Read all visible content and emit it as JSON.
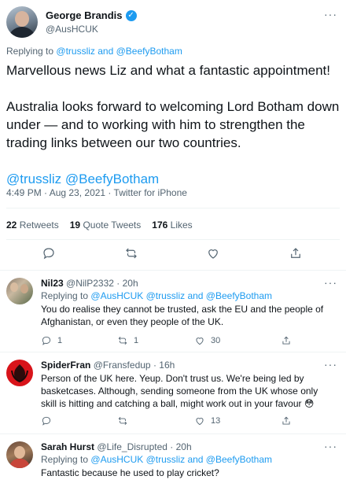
{
  "main_tweet": {
    "author_name": "George Brandis",
    "author_handle": "@AusHCUK",
    "more_glyph": "···",
    "replying_prefix": "Replying to",
    "replying_mentions": "@trussliz and @BeefyBotham",
    "body_paragraph_1": "Marvellous news Liz and what a fantastic appointment!",
    "body_paragraph_2": "Australia looks forward to welcoming Lord Botham down under — and to working with him to strengthen the trading links between our two countries.",
    "body_mentions": "@trussliz @BeefyBotham",
    "timestamp": "4:49 PM · Aug 23, 2021 · Twitter for iPhone",
    "stats": {
      "retweets_count": "22",
      "retweets_label": "Retweets",
      "quotes_count": "19",
      "quotes_label": "Quote Tweets",
      "likes_count": "176",
      "likes_label": "Likes"
    },
    "actions": [
      "reply-icon",
      "retweet-icon",
      "like-icon",
      "share-icon"
    ]
  },
  "replies": [
    {
      "name": "Nil23",
      "handle": "@NilP2332",
      "time": "· 20h",
      "replying_prefix": "Replying to",
      "replying_mentions": "@AusHCUK @trussliz and @BeefyBotham",
      "text": "You do realise they cannot be trusted, ask the EU and the people of Afghanistan, or even they people of the UK.",
      "reply_count": "1",
      "retweet_count": "1",
      "like_count": "30"
    },
    {
      "name": "SpiderFran",
      "handle": "@Fransfedup",
      "time": "· 16h",
      "text": "Person of the UK here. Yeup. Don't trust us. We're being led by basketcases. Although, sending someone from the UK whose only skill is hitting and catching a ball, might work out in your favour 😳",
      "reply_count": "",
      "retweet_count": "",
      "like_count": "13"
    },
    {
      "name": "Sarah Hurst",
      "handle": "@Life_Disrupted",
      "time": "· 20h",
      "replying_prefix": "Replying to",
      "replying_mentions": "@AusHCUK @trussliz and @BeefyBotham",
      "text": "Fantastic because he used to play cricket?"
    }
  ],
  "colors": {
    "accent": "#1d9bf0",
    "muted": "#536471",
    "text": "#0f1419",
    "divider": "#eff3f4"
  }
}
